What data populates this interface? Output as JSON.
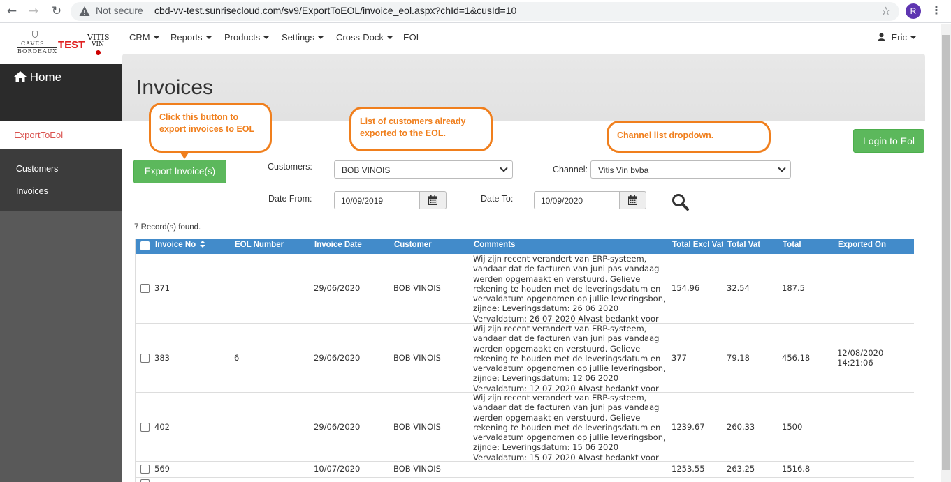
{
  "browser": {
    "security_label": "Not secure",
    "url": "cbd-vv-test.sunrisecloud.com/sv9/ExportToEOL/invoice_eol.aspx?chId=1&cusId=10",
    "profile_initial": "R"
  },
  "logo": {
    "caves": "CAVES",
    "bordeaux": "BORDEAUX",
    "test": "TEST",
    "vitis": "VITIS",
    "vin": "VIN"
  },
  "topnav": {
    "menus": [
      "CRM",
      "Reports",
      "Products",
      "Settings",
      "Cross-Dock",
      "EOL"
    ],
    "user": "Eric"
  },
  "sidebar": {
    "home": "Home",
    "section": "ExportToEol",
    "items": [
      "Customers",
      "Invoices"
    ]
  },
  "page": {
    "title": "Invoices",
    "export_button": "Export Invoice(s)",
    "login_button": "Login to Eol",
    "customers_label": "Customers:",
    "customers_value": "BOB VINOIS",
    "channel_label": "Channel:",
    "channel_value": "Vitis Vin bvba",
    "date_from_label": "Date From:",
    "date_from_value": "10/09/2019",
    "date_to_label": "Date To:",
    "date_to_value": "10/09/2020",
    "records_found": "7 Record(s) found."
  },
  "callouts": {
    "export": "Click this button to export invoices to EOL",
    "customers": "List of customers already exported to the EOL.",
    "channel": "Channel list dropdown."
  },
  "table": {
    "columns": [
      "Invoice No",
      "EOL Number",
      "Invoice Date",
      "Customer",
      "Comments",
      "Total Excl Vat",
      "Total Vat",
      "Total",
      "Exported On"
    ],
    "rows": [
      {
        "invoice_no": "371",
        "eol_number": "",
        "invoice_date": "29/06/2020",
        "customer": "BOB VINOIS",
        "comments": "Wij zijn recent verandert van ERP-systeem, vandaar dat de facturen van juni pas vandaag werden opgemaakt en verstuurd. Gelieve rekening te houden met de leveringsdatum en vervaldatum opgenomen op jullie leveringsbon, zijnde: Leveringsdatum: 26 06 2020 Vervaldatum: 26 07 2020 Alvast bedankt voor jullie begrip.",
        "total_excl": "154.96",
        "total_vat": "32.54",
        "total": "187.5",
        "exported_on": ""
      },
      {
        "invoice_no": "383",
        "eol_number": "6",
        "invoice_date": "29/06/2020",
        "customer": "BOB VINOIS",
        "comments": "Wij zijn recent verandert van ERP-systeem, vandaar dat de facturen van juni pas vandaag werden opgemaakt en verstuurd. Gelieve rekening te houden met de leveringsdatum en vervaldatum opgenomen op jullie leveringsbon, zijnde: Leveringsdatum: 12 06 2020 Vervaldatum: 12 07 2020 Alvast bedankt voor jullie begrip.",
        "total_excl": "377",
        "total_vat": "79.18",
        "total": "456.18",
        "exported_on": "12/08/2020 14:21:06"
      },
      {
        "invoice_no": "402",
        "eol_number": "",
        "invoice_date": "29/06/2020",
        "customer": "BOB VINOIS",
        "comments": "Wij zijn recent verandert van ERP-systeem, vandaar dat de facturen van juni pas vandaag werden opgemaakt en verstuurd. Gelieve rekening te houden met de leveringsdatum en vervaldatum opgenomen op jullie leveringsbon, zijnde: Leveringsdatum: 15 06 2020 Vervaldatum: 15 07 2020 Alvast bedankt voor jullie begrip.",
        "total_excl": "1239.67",
        "total_vat": "260.33",
        "total": "1500",
        "exported_on": ""
      },
      {
        "invoice_no": "569",
        "eol_number": "",
        "invoice_date": "10/07/2020",
        "customer": "BOB VINOIS",
        "comments": "",
        "total_excl": "1253.55",
        "total_vat": "263.25",
        "total": "1516.8",
        "exported_on": ""
      }
    ]
  },
  "colors": {
    "accent_blue": "#428bca",
    "green": "#5cb85c",
    "callout_orange": "#f07f1d",
    "sidebar_active_red": "#d9534f"
  }
}
